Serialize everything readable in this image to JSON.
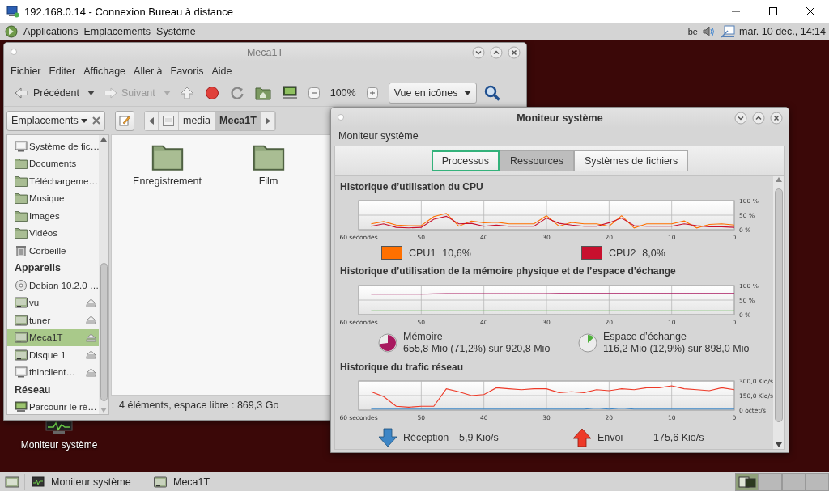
{
  "remote_desktop": {
    "title": "192.168.0.14 - Connexion Bureau à distance"
  },
  "panel": {
    "menus": [
      "Applications",
      "Emplacements",
      "Système"
    ],
    "keyboard": "be",
    "clock": "mar. 10 déc., 14:14"
  },
  "desktop_icons": [
    {
      "label": "Moniteur système"
    }
  ],
  "file_manager": {
    "title": "Meca1T",
    "menu": [
      "Fichier",
      "Editer",
      "Affichage",
      "Aller à",
      "Favoris",
      "Aide"
    ],
    "toolbar": {
      "back": {
        "label": "Précédent",
        "disabled": false
      },
      "forward": {
        "label": "Suivant",
        "disabled": true
      },
      "zoom": "100%",
      "view": "Vue en icônes"
    },
    "places_button": "Emplacements",
    "path": [
      {
        "label": "media",
        "selected": false
      },
      {
        "label": "Meca1T",
        "selected": true
      }
    ],
    "sidebar": [
      {
        "items": [
          {
            "kind": "computer",
            "label": "Système de fic…",
            "ejectable": false,
            "selected": false
          },
          {
            "kind": "folder",
            "label": "Documents",
            "ejectable": false,
            "selected": false
          },
          {
            "kind": "folder",
            "label": "Téléchargeme…",
            "ejectable": false,
            "selected": false
          },
          {
            "kind": "folder",
            "label": "Musique",
            "ejectable": false,
            "selected": false
          },
          {
            "kind": "folder",
            "label": "Images",
            "ejectable": false,
            "selected": false
          },
          {
            "kind": "folder",
            "label": "Vidéos",
            "ejectable": false,
            "selected": false
          },
          {
            "kind": "trash",
            "label": "Corbeille",
            "ejectable": false,
            "selected": false
          }
        ]
      },
      {
        "title": "Appareils",
        "items": [
          {
            "kind": "optical",
            "label": "Debian 10.2.0 …",
            "ejectable": false,
            "selected": false
          },
          {
            "kind": "drive",
            "label": "vu",
            "ejectable": true,
            "selected": false
          },
          {
            "kind": "drive",
            "label": "tuner",
            "ejectable": true,
            "selected": false
          },
          {
            "kind": "drive",
            "label": "Meca1T",
            "ejectable": true,
            "selected": true
          },
          {
            "kind": "drive",
            "label": "Disque 1",
            "ejectable": true,
            "selected": false
          },
          {
            "kind": "computer",
            "label": "thinclient…",
            "ejectable": true,
            "selected": false
          }
        ]
      },
      {
        "title": "Réseau",
        "items": [
          {
            "kind": "network",
            "label": "Parcourir le ré…",
            "ejectable": false,
            "selected": false
          }
        ]
      }
    ],
    "files": [
      "Enregistrement",
      "Film"
    ],
    "status": "4 éléments, espace libre : 869,3 Go"
  },
  "system_monitor": {
    "title": "Moniteur système",
    "app_menu": "Moniteur système",
    "tabs": [
      {
        "label": "Processus",
        "selected": false,
        "focused": true
      },
      {
        "label": "Ressources",
        "selected": true,
        "focused": false
      },
      {
        "label": "Systèmes de fichiers",
        "selected": false,
        "focused": false
      }
    ],
    "cpu": {
      "heading": "Historique d’utilisation du CPU",
      "chart_data": {
        "type": "line",
        "grid": true,
        "x": [
          58,
          56,
          54,
          52,
          50,
          48,
          46,
          44,
          42,
          40,
          38,
          36,
          34,
          32,
          30,
          28,
          26,
          24,
          22,
          20,
          18,
          16,
          14,
          12,
          10,
          8,
          6,
          4,
          2,
          0
        ],
        "xlim": [
          60,
          0
        ],
        "ylim": [
          0,
          100
        ],
        "xticks": [
          {
            "value": 60,
            "label": "60 secondes"
          },
          50,
          40,
          30,
          20,
          10,
          0
        ],
        "yticks": [
          {
            "value": 0,
            "label": "0 %"
          },
          {
            "value": 50,
            "label": "50 %"
          },
          {
            "value": 100,
            "label": "100 %"
          }
        ],
        "series": [
          {
            "name": "CPU1",
            "color": "#ff7000",
            "values": [
              20,
              28,
              16,
              14,
              14,
              45,
              56,
              12,
              30,
              24,
              26,
              20,
              20,
              20,
              48,
              12,
              25,
              20,
              20,
              12,
              48,
              6,
              20,
              20,
              20,
              30,
              6,
              18,
              20,
              16
            ]
          },
          {
            "name": "CPU2",
            "color": "#c8102e",
            "values": [
              12,
              20,
              8,
              6,
              8,
              36,
              46,
              20,
              22,
              12,
              16,
              12,
              12,
              12,
              40,
              22,
              16,
              12,
              12,
              24,
              40,
              14,
              12,
              12,
              12,
              20,
              14,
              10,
              10,
              8
            ]
          }
        ]
      },
      "legend": [
        {
          "value": "10,6%"
        },
        {
          "value": "8,0%"
        }
      ]
    },
    "memory": {
      "heading": "Historique d’utilisation de la mémoire physique et de l’espace d’échange",
      "chart_data": {
        "type": "line",
        "grid": true,
        "x": [
          58,
          56,
          54,
          52,
          50,
          48,
          46,
          44,
          42,
          40,
          38,
          36,
          34,
          32,
          30,
          28,
          26,
          24,
          22,
          20,
          18,
          16,
          14,
          12,
          10,
          8,
          6,
          4,
          2,
          0
        ],
        "xlim": [
          60,
          0
        ],
        "ylim": [
          0,
          100
        ],
        "xticks": [
          {
            "value": 60,
            "label": "60 secondes"
          },
          50,
          40,
          30,
          20,
          10,
          0
        ],
        "yticks": [
          {
            "value": 0,
            "label": "0 %"
          },
          {
            "value": 50,
            "label": "50 %"
          },
          {
            "value": 100,
            "label": "100 %"
          }
        ],
        "series": [
          {
            "name": "Mémoire",
            "color": "#a8195f",
            "values": [
              70,
              70,
              70,
              70,
              70,
              71,
              72,
              72,
              72,
              72,
              72,
              72,
              72,
              72,
              72,
              73,
              73,
              73,
              73,
              73,
              73,
              73,
              73,
              73,
              73,
              73,
              73,
              73,
              73,
              73
            ]
          },
          {
            "name": "Espace d’échange",
            "color": "#4eb03a",
            "values": [
              13,
              13,
              13,
              13,
              13,
              13,
              13,
              13,
              13,
              13,
              13,
              13,
              13,
              13,
              13,
              13,
              13,
              13,
              13,
              13,
              13,
              13,
              13,
              13,
              13,
              13,
              13,
              13,
              13,
              13
            ]
          }
        ]
      },
      "legend": [
        {
          "detail": "655,8 Mio (71,2%) sur 920,8 Mio"
        },
        {
          "detail": "116,2 Mio (12,9%) sur 898,0 Mio"
        }
      ]
    },
    "network": {
      "heading": "Historique du trafic réseau",
      "chart_data": {
        "type": "line",
        "grid": true,
        "x": [
          58,
          56,
          54,
          52,
          50,
          48,
          46,
          44,
          42,
          40,
          38,
          36,
          34,
          32,
          30,
          28,
          26,
          24,
          22,
          20,
          18,
          16,
          14,
          12,
          10,
          8,
          6,
          4,
          2,
          0
        ],
        "xlim": [
          60,
          0
        ],
        "ylim": [
          0,
          300
        ],
        "xticks": [
          {
            "value": 60,
            "label": "60 secondes"
          },
          50,
          40,
          30,
          20,
          10,
          0
        ],
        "yticks": [
          {
            "value": 0,
            "label": "0 octet/s"
          },
          {
            "value": 150,
            "label": "150,0 Kio/s"
          },
          {
            "value": 300,
            "label": "300,0 Kio/s"
          }
        ],
        "series": [
          {
            "name": "Réception",
            "color": "#3d86c6",
            "values": [
              10,
              10,
              10,
              10,
              10,
              10,
              10,
              10,
              10,
              10,
              10,
              10,
              10,
              10,
              10,
              10,
              10,
              10,
              20,
              10,
              20,
              10,
              10,
              10,
              10,
              10,
              10,
              10,
              10,
              10
            ]
          },
          {
            "name": "Envoi",
            "color": "#ee3a28",
            "values": [
              190,
              140,
              40,
              30,
              40,
              40,
              220,
              190,
              150,
              160,
              230,
              220,
              210,
              220,
              220,
              180,
              190,
              180,
              210,
              200,
              220,
              210,
              230,
              230,
              250,
              220,
              210,
              200,
              230,
              210
            ]
          }
        ]
      },
      "legend": [
        {
          "kind": "receive",
          "value": "5,9 Kio/s"
        },
        {
          "kind": "send",
          "value": "175,6 Kio/s"
        }
      ]
    }
  },
  "taskbar": {
    "tasks": [
      {
        "kind": "monitor",
        "label": "Moniteur système"
      },
      {
        "kind": "drive",
        "label": "Meca1T"
      }
    ],
    "workspaces": [
      {
        "selected": true
      },
      {
        "selected": false
      },
      {
        "selected": false
      },
      {
        "selected": false
      }
    ]
  }
}
